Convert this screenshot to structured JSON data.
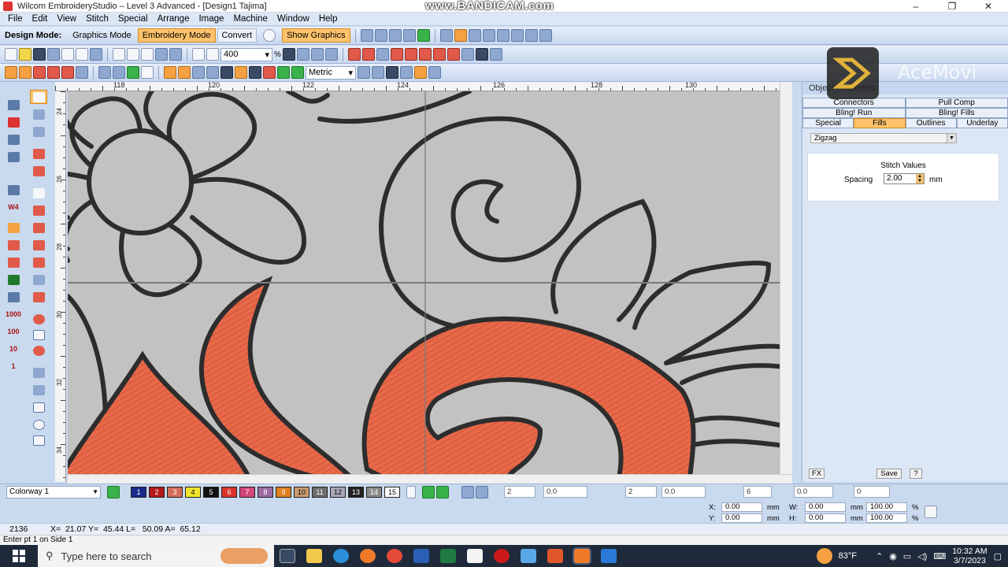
{
  "window": {
    "title": "Wilcom EmbroideryStudio – Level 3 Advanced - [Design1        Tajima]",
    "watermark": "www.BANDICAM.com",
    "controls": [
      "–",
      "❐",
      "✕"
    ]
  },
  "menu": [
    "File",
    "Edit",
    "View",
    "Stitch",
    "Special",
    "Arrange",
    "Image",
    "Machine",
    "Window",
    "Help"
  ],
  "mode_toolbar": {
    "label": "Design Mode:",
    "graphics_mode": "Graphics Mode",
    "embroidery_mode": "Embroidery Mode",
    "convert": "Convert",
    "show_graphics": "Show Graphics"
  },
  "standard_toolbar": {
    "zoom": "400",
    "zoom_unit": "%"
  },
  "view_toolbar": {
    "units": "Metric"
  },
  "rulers": {
    "top": [
      "118",
      "120",
      "122",
      "124",
      "126",
      "128",
      "130"
    ],
    "left": [
      "24",
      "26",
      "28",
      "30",
      "32",
      "34"
    ]
  },
  "docker": {
    "title": "Object Properties",
    "tabs_row1": [
      "Connectors",
      "Pull Comp"
    ],
    "tabs_row2": [
      "Bling! Run",
      "Bling! Fills"
    ],
    "tabs_row3": [
      "Special",
      "Fills",
      "Outlines",
      "Underlay"
    ],
    "fill_type": "Zigzag",
    "section_title": "Stitch Values",
    "spacing_label": "Spacing",
    "spacing_value": "2.00",
    "spacing_unit": "mm",
    "fx_button": "FX",
    "save_button": "Save",
    "help_button": "?"
  },
  "colorway": {
    "name": "Colorway 1",
    "swatches": [
      {
        "n": "1",
        "color": "#1b2a8a"
      },
      {
        "n": "2",
        "color": "#b31818"
      },
      {
        "n": "3",
        "color": "#d66b5c"
      },
      {
        "n": "4",
        "color": "#f0e42a"
      },
      {
        "n": "5",
        "color": "#111111"
      },
      {
        "n": "6",
        "color": "#d9342a"
      },
      {
        "n": "7",
        "color": "#d2467a"
      },
      {
        "n": "8",
        "color": "#9c6aa0"
      },
      {
        "n": "9",
        "color": "#e07f1e"
      },
      {
        "n": "10",
        "color": "#c99a70"
      },
      {
        "n": "11",
        "color": "#6e6e6e"
      },
      {
        "n": "12",
        "color": "#a7a7b8"
      },
      {
        "n": "13",
        "color": "#222222"
      },
      {
        "n": "14",
        "color": "#8a8a8a"
      },
      {
        "n": "15",
        "color": "#ffffff"
      }
    ],
    "field_values": [
      "2",
      "0.0",
      "2",
      "0.0",
      "6",
      "0.0",
      "0"
    ]
  },
  "coords": {
    "x_label": "X:",
    "x": "0.00",
    "x_unit": "mm",
    "y_label": "Y:",
    "y": "0.00",
    "y_unit": "mm",
    "w_label": "W:",
    "w": "0.00",
    "w_unit": "mm",
    "h_label": "H:",
    "h": "0.00",
    "h_unit": "mm",
    "wp": "100.00",
    "hp": "100.00",
    "pct": "%"
  },
  "status": {
    "stitch_count": "2136",
    "readout": "X=  21.07 Y=  45.44 L=   50.09 A=  65.12",
    "prompt": "Enter pt 1 on Side 1"
  },
  "taskbar": {
    "search_placeholder": "Type here to search",
    "weather": "83°F",
    "time": "10:32 AM",
    "date": "3/7/2023",
    "overlay_brand": "AceMovi"
  },
  "colors": {
    "accent": "#ffc36b",
    "chrome": "#c9d9ee",
    "canvas": "#c2c2c2",
    "fill": "#e8694a",
    "outline": "#2d2d2d"
  }
}
